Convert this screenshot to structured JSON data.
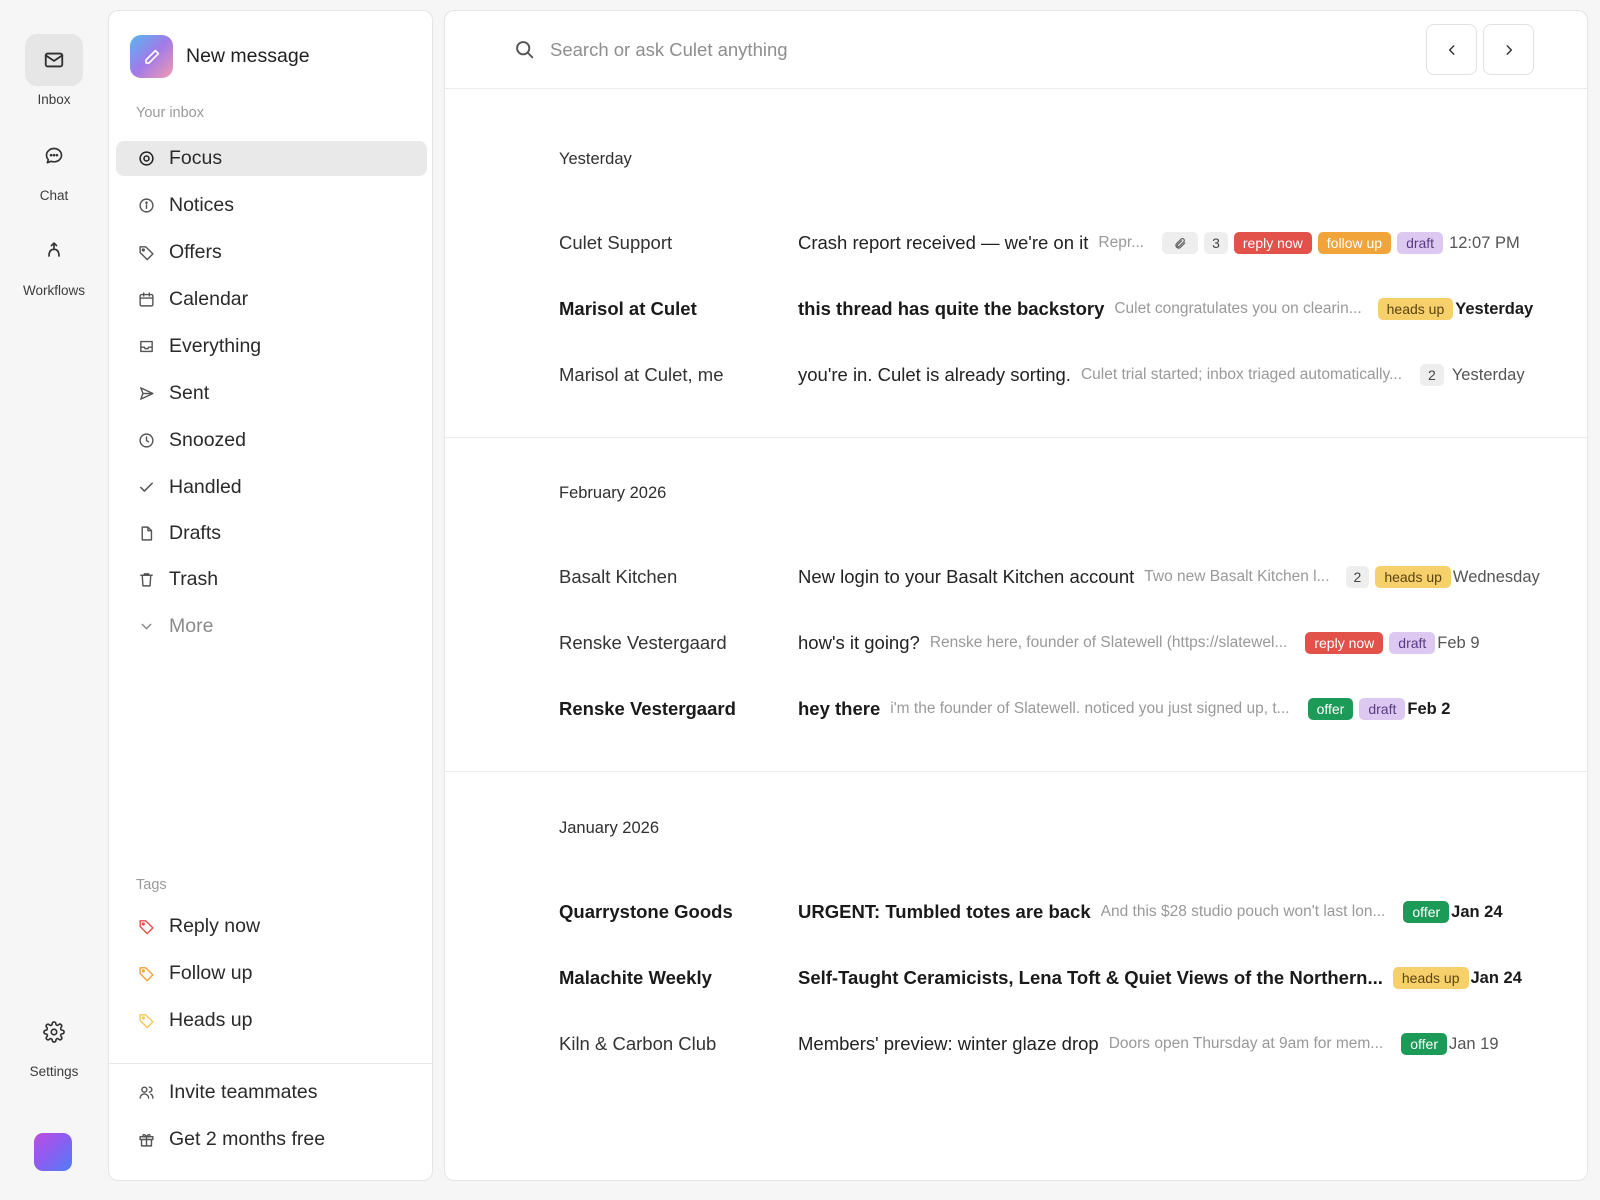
{
  "rail": {
    "inbox": "Inbox",
    "chat": "Chat",
    "workflows": "Workflows",
    "settings": "Settings"
  },
  "sidebar": {
    "new_message": "New message",
    "inbox_section": "Your inbox",
    "items": [
      {
        "label": "Focus",
        "icon": "target-icon"
      },
      {
        "label": "Notices",
        "icon": "info-icon"
      },
      {
        "label": "Offers",
        "icon": "tag-icon"
      },
      {
        "label": "Calendar",
        "icon": "calendar-icon"
      },
      {
        "label": "Everything",
        "icon": "tray-icon"
      },
      {
        "label": "Sent",
        "icon": "send-icon"
      },
      {
        "label": "Snoozed",
        "icon": "clock-icon"
      },
      {
        "label": "Handled",
        "icon": "check-icon"
      },
      {
        "label": "Drafts",
        "icon": "file-icon"
      },
      {
        "label": "Trash",
        "icon": "trash-icon"
      },
      {
        "label": "More",
        "icon": "chevron-down-icon"
      }
    ],
    "tags_section": "Tags",
    "tags": [
      {
        "label": "Reply now",
        "color": "#e2524a"
      },
      {
        "label": "Follow up",
        "color": "#f0a43a"
      },
      {
        "label": "Heads up",
        "color": "#f6c85a"
      }
    ],
    "invite": "Invite teammates",
    "free": "Get 2 months free"
  },
  "search": {
    "placeholder": "Search or ask Culet anything"
  },
  "groups": [
    {
      "label": "Yesterday",
      "rows": [
        {
          "sender": "Culet Support",
          "subject": "Crash report received — we're on it",
          "snippet": "Repr...",
          "attachment": true,
          "count": "3",
          "tags": [
            "reply now",
            "follow up",
            "draft"
          ],
          "time": "12:07 PM",
          "bold": false
        },
        {
          "sender": "Marisol at Culet",
          "subject": "this thread has quite the backstory",
          "snippet": "Culet congratulates you on clearin...",
          "tags": [
            "heads up"
          ],
          "time": "Yesterday",
          "bold": true
        },
        {
          "sender": "Marisol at Culet, me",
          "subject": "you're in. Culet is already sorting.",
          "snippet": "Culet trial started; inbox triaged automatically...",
          "count": "2",
          "tags": [],
          "time": "Yesterday",
          "bold": false
        }
      ]
    },
    {
      "label": "February 2026",
      "rows": [
        {
          "sender": "Basalt Kitchen",
          "subject": "New login to your Basalt Kitchen account",
          "snippet": "Two new Basalt Kitchen l...",
          "count": "2",
          "tags": [
            "heads up"
          ],
          "time": "Wednesday",
          "bold": false
        },
        {
          "sender": "Renske Vestergaard",
          "subject": "how's it going?",
          "snippet": "Renske here, founder of Slatewell (https://slatewel...",
          "tags": [
            "reply now",
            "draft"
          ],
          "time": "Feb 9",
          "bold": false
        },
        {
          "sender": "Renske Vestergaard",
          "subject": "hey there",
          "snippet": "i'm the founder of Slatewell. noticed you just signed up, t...",
          "tags": [
            "offer",
            "draft"
          ],
          "time": "Feb 2",
          "bold": true
        }
      ]
    },
    {
      "label": "January 2026",
      "rows": [
        {
          "sender": "Quarrystone Goods",
          "subject": "URGENT: Tumbled totes are back",
          "snippet": "And this $28 studio pouch won't last lon...",
          "tags": [
            "offer"
          ],
          "time": "Jan 24",
          "bold": true
        },
        {
          "sender": "Malachite Weekly",
          "subject": "Self-Taught Ceramicists, Lena Toft & Quiet Views of the Northern...",
          "snippet": "",
          "tags": [
            "heads up"
          ],
          "time": "Jan 24",
          "bold": true
        },
        {
          "sender": "Kiln & Carbon Club",
          "subject": "Members' preview: winter glaze drop",
          "snippet": "Doors open Thursday at 9am for mem...",
          "tags": [
            "offer"
          ],
          "time": "Jan 19",
          "bold": false
        }
      ]
    }
  ],
  "colors": {
    "reply_now": "#e2524a",
    "follow_up": "#f0a43a",
    "draft": "#ddc8f2",
    "heads_up": "#f6d06a",
    "offer": "#1c9a58"
  }
}
